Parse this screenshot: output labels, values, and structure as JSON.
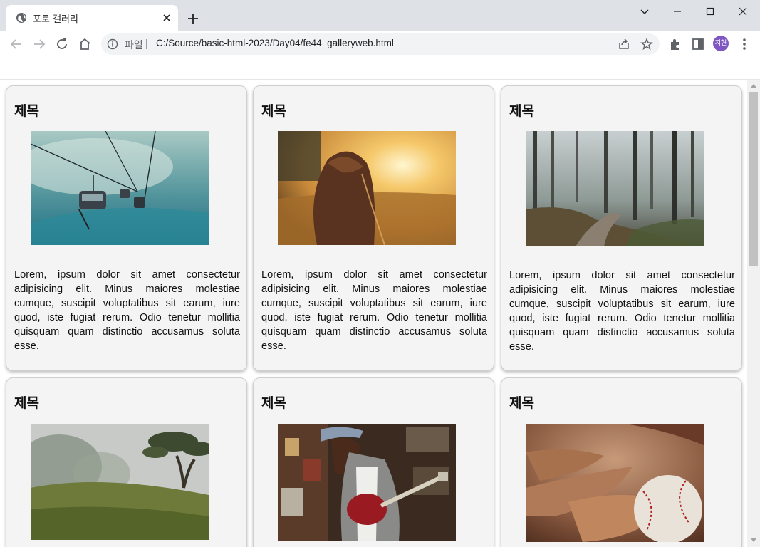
{
  "browser": {
    "tab_title": "포토 갤러리",
    "scheme_label": "파일",
    "url": "C:/Source/basic-html-2023/Day04/fe44_galleryweb.html",
    "profile_initials": "지현"
  },
  "gallery": {
    "cards": [
      {
        "title": "제목",
        "image": "ski-lift-in-fog-photo",
        "text": "Lorem, ipsum dolor sit amet consectetur adipisicing elit. Minus maiores molestiae cumque, suscipit voluptatibus sit earum, iure quod, iste fugiat rerum. Odio tenetur mollitia quisquam quam distinctio accusamus soluta esse."
      },
      {
        "title": "제목",
        "image": "girl-in-sunset-field-photo",
        "text": "Lorem, ipsum dolor sit amet consectetur adipisicing elit. Minus maiores molestiae cumque, suscipit voluptatibus sit earum, iure quod, iste fugiat rerum. Odio tenetur mollitia quisquam quam distinctio accusamus soluta esse."
      },
      {
        "title": "제목",
        "image": "misty-forest-path-photo",
        "text": "Lorem, ipsum dolor sit amet consectetur adipisicing elit. Minus maiores molestiae cumque, suscipit voluptatibus sit earum, iure quod, iste fugiat rerum. Odio tenetur mollitia quisquam quam distinctio accusamus soluta esse."
      },
      {
        "title": "제목",
        "image": "foggy-hill-tree-photo",
        "text": ""
      },
      {
        "title": "제목",
        "image": "woman-playing-guitar-photo",
        "text": ""
      },
      {
        "title": "제목",
        "image": "baseball-glove-photo",
        "text": ""
      }
    ]
  },
  "colors": {
    "chrome_bg": "#dee1e6",
    "card_bg": "#f4f4f4",
    "avatar": "#7e57c2"
  }
}
